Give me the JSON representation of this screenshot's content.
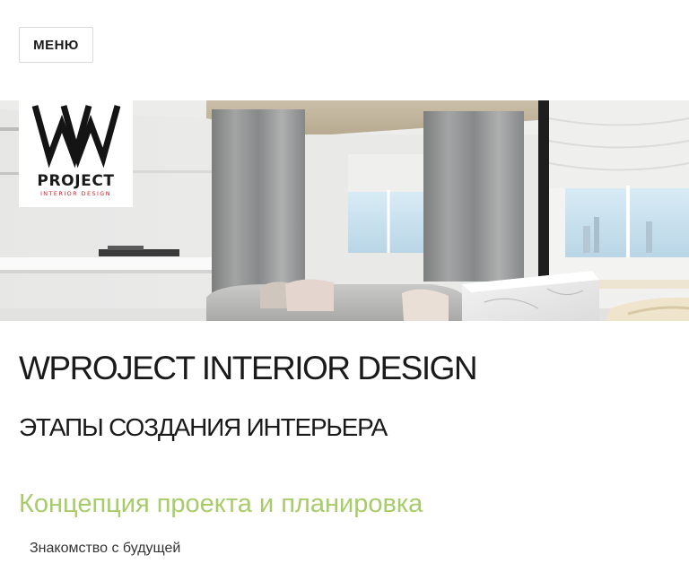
{
  "header": {
    "menu_label": "МЕНЮ"
  },
  "logo": {
    "mark": "W",
    "name": "PROJECT",
    "tagline": "INTERIOR DESIGN"
  },
  "hero": {
    "image": "interior-living-room-photo"
  },
  "main": {
    "site_title": "WPROJECT INTERIOR DESIGN",
    "page_title": "ЭТАПЫ СОЗДАНИЯ ИНТЕРЬЕРА",
    "section_title": "Концепция проекта и планировка",
    "paragraph_start": "Знакомство с будущей"
  },
  "colors": {
    "section_accent": "#a8cc6a",
    "logo_red": "#d21f26"
  }
}
